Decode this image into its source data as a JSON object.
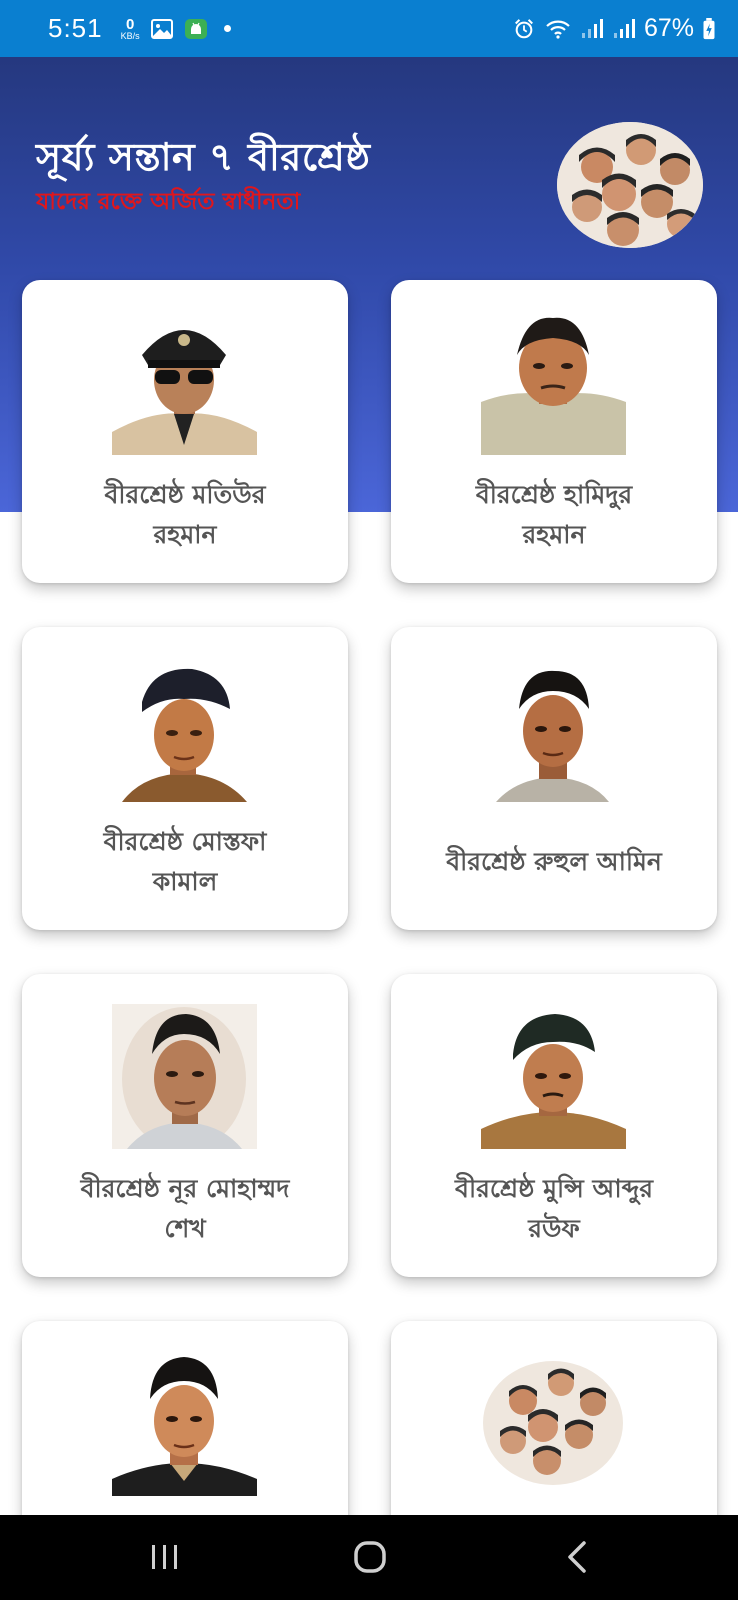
{
  "status_bar": {
    "time": "5:51",
    "net_speed_value": "0",
    "net_speed_unit": "KB/s",
    "battery_percent": "67%",
    "icons": [
      "image-icon",
      "android-icon",
      "dot-icon",
      "alarm-icon",
      "wifi-icon",
      "signal-icon",
      "signal-icon",
      "battery-charging-icon"
    ]
  },
  "header": {
    "title": "সূর্য্য সন্তান ৭ বীরশ্রেষ্ঠ",
    "subtitle": "যাদের রক্তে অর্জিত স্বাধীনতা",
    "colors": {
      "title": "#ffffff",
      "subtitle": "#e0161c",
      "gradient_top": "#25387f",
      "gradient_bottom": "#4b66d8"
    }
  },
  "cards": [
    {
      "name_line1": "বীরশ্রেষ্ঠ মতিউর",
      "name_line2": "রহমান"
    },
    {
      "name_line1": "বীরশ্রেষ্ঠ হামিদুর",
      "name_line2": "রহমান"
    },
    {
      "name_line1": "বীরশ্রেষ্ঠ মোস্তফা",
      "name_line2": "কামাল"
    },
    {
      "name_line1": "বীরশ্রেষ্ঠ রুহুল আমিন",
      "name_line2": ""
    },
    {
      "name_line1": "বীরশ্রেষ্ঠ নূর মোহাম্মদ",
      "name_line2": "শেখ"
    },
    {
      "name_line1": "বীরশ্রেষ্ঠ মুন্সি আব্দুর",
      "name_line2": "রউফ"
    },
    {
      "name_line1": "",
      "name_line2": ""
    },
    {
      "name_line1": "",
      "name_line2": ""
    }
  ],
  "nav_bar": {
    "icons": [
      "recents-icon",
      "home-icon",
      "back-icon"
    ]
  }
}
